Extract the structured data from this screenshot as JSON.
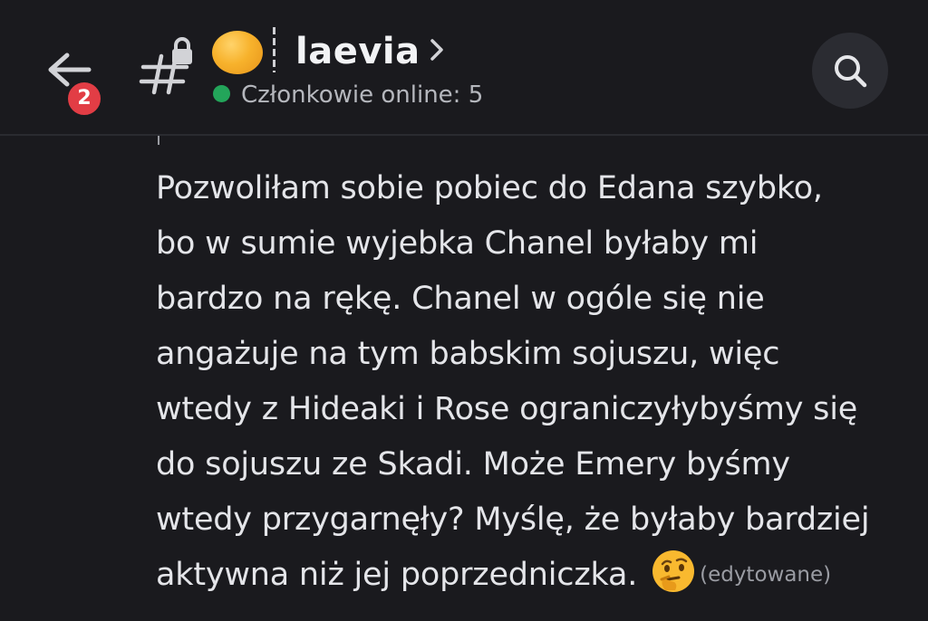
{
  "header": {
    "back_icon": "arrow-left-icon",
    "notification_count": "2",
    "channel_icon": "hash-lock-icon",
    "channel_emoji": "orange-circle-emoji",
    "channel_name": "laevia",
    "chevron_icon": "chevron-right-icon",
    "online_label": "Członkowie online: 5",
    "online_color": "#23a55a",
    "search_icon": "search-icon"
  },
  "message": {
    "lines": [
      "Pozwoliłam sobie pobiec do Edana szybko,",
      "bo w sumie wyjebka Chanel byłaby mi",
      "bardzo na rękę. Chanel w ogóle się nie",
      "angażuje na tym babskim sojuszu, więc",
      "wtedy z Hideaki i Rose ograniczyłybyśmy się",
      "do sojuszu ze Skadi. Może Emery byśmy",
      "wtedy przygarnęły? Myślę, że byłaby bardziej",
      "aktywna niż jej poprzedniczka."
    ],
    "emoji": "thinking-face-emoji",
    "edited_label": "(edytowane)"
  },
  "colors": {
    "background": "#1a1a1e",
    "badge": "#e23d45",
    "text": "#e4e5e9",
    "muted": "#9a9ca3"
  }
}
